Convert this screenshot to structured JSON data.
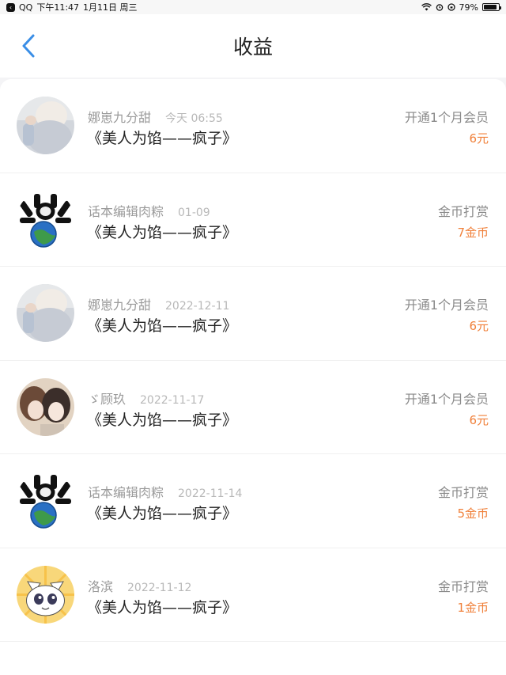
{
  "status_bar": {
    "app_label": "QQ",
    "time": "下午11:47",
    "date": "1月11日 周三",
    "battery": "79%",
    "battery_level": 0.79
  },
  "header": {
    "title": "收益",
    "back_icon": "chevron-left-icon"
  },
  "colors": {
    "accent": "#3a8ee6",
    "amount": "#f0803a"
  },
  "rows": [
    {
      "avatar": "avatar-cat-hood",
      "name": "娜崽九分甜",
      "date": "今天 06:55",
      "book": "《美人为馅——疯子》",
      "type": "开通1个月会员",
      "amount": "6元"
    },
    {
      "avatar": "avatar-earth-dogs",
      "name": "话本编辑肉粽",
      "date": "01-09",
      "book": "《美人为馅——疯子》",
      "type": "金币打赏",
      "amount": "7金币"
    },
    {
      "avatar": "avatar-cat-hood",
      "name": "娜崽九分甜",
      "date": "2022-12-11",
      "book": "《美人为馅——疯子》",
      "type": "开通1个月会员",
      "amount": "6元"
    },
    {
      "avatar": "avatar-anime-couple",
      "name": "ゞ顾玖",
      "date": "2022-11-17",
      "book": "《美人为馅——疯子》",
      "type": "开通1个月会员",
      "amount": "6元"
    },
    {
      "avatar": "avatar-earth-dogs",
      "name": "话本编辑肉粽",
      "date": "2022-11-14",
      "book": "《美人为馅——疯子》",
      "type": "金币打赏",
      "amount": "5金币"
    },
    {
      "avatar": "avatar-cartoon-cat",
      "name": "洛滨",
      "date": "2022-11-12",
      "book": "《美人为馅——疯子》",
      "type": "金币打赏",
      "amount": "1金币"
    }
  ]
}
